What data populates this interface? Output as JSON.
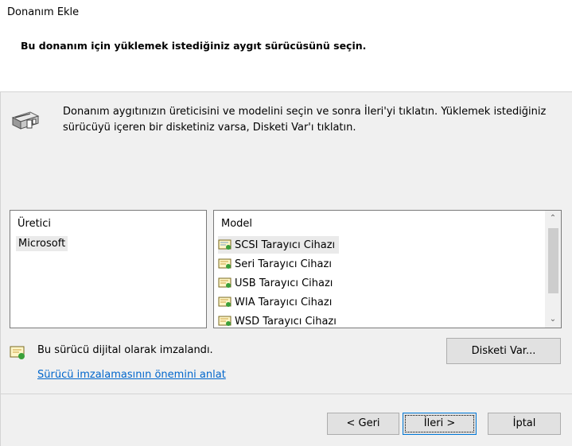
{
  "window": {
    "title": "Donanım Ekle"
  },
  "header": {
    "subtitle": "Bu donanım için yüklemek istediğiniz aygıt sürücüsünü seçin."
  },
  "instruction": "Donanım aygıtınızın üreticisini ve modelini seçin ve sonra İleri'yi tıklatın. Yüklemek istediğiniz sürücüyü içeren bir disketiniz varsa, Disketi Var'ı tıklatın.",
  "manufacturer_list": {
    "header": "Üretici",
    "items": [
      "Microsoft"
    ]
  },
  "model_list": {
    "header": "Model",
    "items": [
      "SCSI Tarayıcı Cihazı",
      "Seri Tarayıcı Cihazı",
      "USB Tarayıcı Cihazı",
      "WIA Tarayıcı Cihazı",
      "WSD Tarayıcı Cihazı"
    ]
  },
  "signed_text": "Bu sürücü dijital olarak imzalandı.",
  "signing_link": "Sürücü imzalamasının önemini anlat",
  "buttons": {
    "have_disk": "Disketi Var...",
    "back": "< Geri",
    "next": "İleri >",
    "cancel": "İptal"
  },
  "icons": {
    "scanner": "scanner-icon",
    "driver": "driver-certificate-icon",
    "scroll_up": "chevron-up-icon",
    "scroll_down": "chevron-down-icon"
  },
  "colors": {
    "link": "#0066cc",
    "focus_border": "#0078d7"
  }
}
